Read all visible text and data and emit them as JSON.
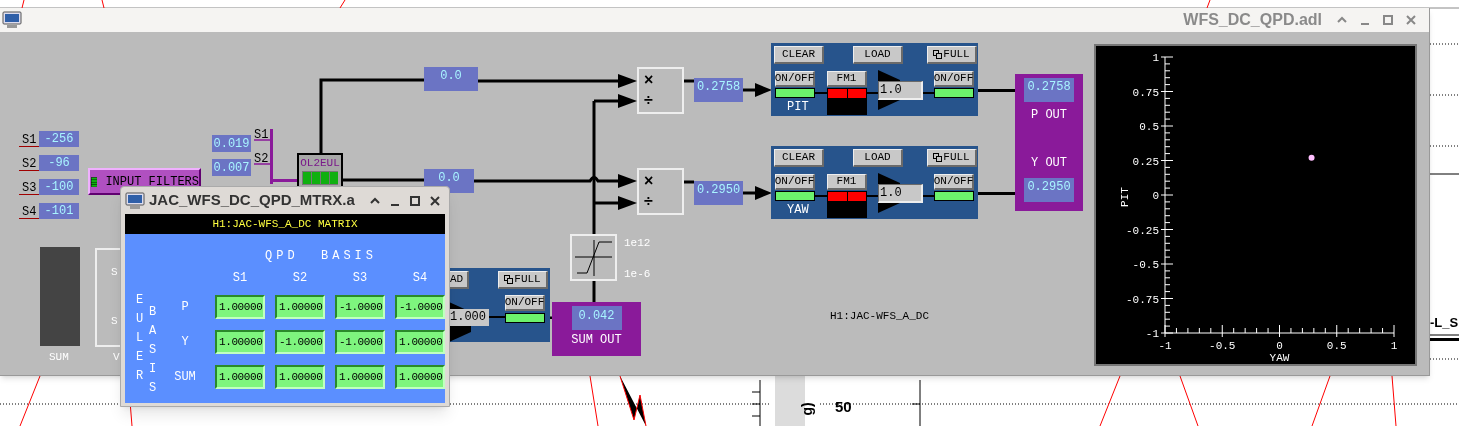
{
  "background": {
    "axis_value": "50",
    "axis_label": "g)",
    "trace_label": "-L_S"
  },
  "main_window": {
    "title": "WFS_DC_QPD.adl"
  },
  "inputs": [
    {
      "label": "S1",
      "value": "-256"
    },
    {
      "label": "S2",
      "value": "-96"
    },
    {
      "label": "S3",
      "value": "-100"
    },
    {
      "label": "S4",
      "value": "-101"
    }
  ],
  "input_filters": {
    "label": "INPUT FILTERS"
  },
  "sum_meter": {
    "label": "SUM"
  },
  "covered_panel": {
    "labels": [
      "S",
      "S"
    ],
    "caption": "V"
  },
  "ol2eul_inputs": [
    {
      "value": "0.019",
      "label": "S1"
    },
    {
      "value": "0.007",
      "label": "S2"
    }
  ],
  "ol2eul": {
    "label": "OL2EUL"
  },
  "euler_values": [
    "0.0",
    "0.0"
  ],
  "operators": [
    {
      "multiply": "×",
      "divide": "÷",
      "output": "0.2758"
    },
    {
      "multiply": "×",
      "divide": "÷",
      "output": "0.2950"
    }
  ],
  "limiter": {
    "high": "1e12",
    "low": "1e-6"
  },
  "sum_filter": {
    "load": "AD",
    "full": "FULL",
    "switch": "ON/OFF",
    "switch_on": true,
    "gain": "1.000"
  },
  "sum_out": {
    "value": "0.042",
    "label": "SUM OUT"
  },
  "filter_banks": [
    {
      "name": "PIT",
      "clear": "CLEAR",
      "load": "LOAD",
      "full": "FULL",
      "input_switch": "ON/OFF",
      "input_on": true,
      "module": "FM1",
      "module_on": false,
      "gain": "1.0",
      "output_switch": "ON/OFF",
      "output_on": true
    },
    {
      "name": "YAW",
      "clear": "CLEAR",
      "load": "LOAD",
      "full": "FULL",
      "input_switch": "ON/OFF",
      "input_on": true,
      "module": "FM1",
      "module_on": false,
      "gain": "1.0",
      "output_switch": "ON/OFF",
      "output_on": true
    }
  ],
  "outputs": {
    "p_value": "0.2758",
    "p_label": "P OUT",
    "y_label": "Y OUT",
    "y_value": "0.2950"
  },
  "channel_label": "H1:JAC-WFS_A_DC",
  "plot": {
    "chart_data": {
      "type": "scatter",
      "xlabel": "YAW",
      "ylabel": "PIT",
      "x": [
        0.28
      ],
      "values": [
        0.27
      ],
      "xlim": [
        -1,
        1
      ],
      "ylim": [
        -1,
        1
      ],
      "xticks": [
        -1,
        -0.5,
        0,
        0.5,
        1
      ],
      "yticks": [
        -1,
        -0.75,
        -0.5,
        -0.25,
        0,
        0.25,
        0.5,
        0.75,
        1
      ]
    }
  },
  "matrix_window": {
    "title": "JAC_WFS_DC_QPD_MTRX.a",
    "header": "H1:JAC-WFS_A_DC MATRIX",
    "column_group": "QPD  BASIS",
    "row_group_outer": "EULER",
    "row_group_inner": "BASIS",
    "columns": [
      "S1",
      "S2",
      "S3",
      "S4"
    ],
    "rows": [
      {
        "label": "P",
        "cells": [
          "1.00000",
          "1.00000",
          "-1.0000",
          "-1.0000"
        ]
      },
      {
        "label": "Y",
        "cells": [
          "1.00000",
          "-1.0000",
          "-1.0000",
          "1.00000"
        ]
      },
      {
        "label": "SUM",
        "cells": [
          "1.00000",
          "1.00000",
          "1.00000",
          "1.00000"
        ]
      }
    ]
  }
}
